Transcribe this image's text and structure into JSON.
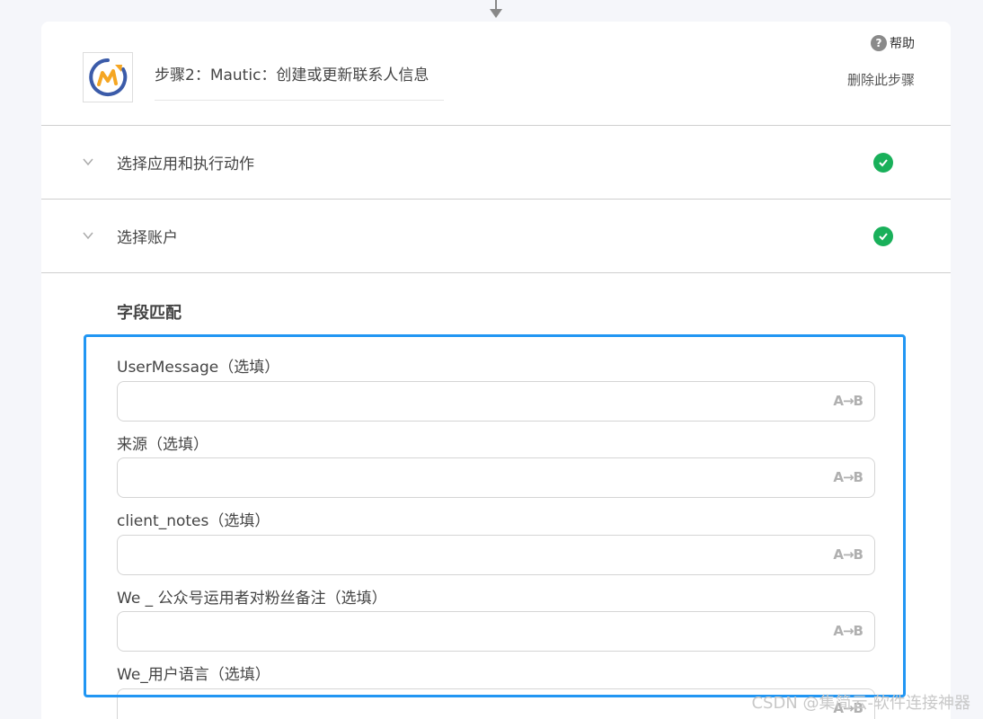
{
  "step": {
    "title": "步骤2：Mautic：创建或更新联系人信息",
    "help_label": "帮助",
    "help_icon": "?",
    "delete_label": "删除此步骤",
    "logo": "mautic-logo"
  },
  "sections": [
    {
      "label": "选择应用和执行动作",
      "status": "complete"
    },
    {
      "label": "选择账户",
      "status": "complete"
    }
  ],
  "mapping": {
    "title": "字段匹配",
    "fields": [
      {
        "label": "UserMessage（选填）",
        "value": "",
        "icon": "A→B"
      },
      {
        "label": "来源（选填）",
        "value": "",
        "icon": "A→B"
      },
      {
        "label": "client_notes（选填）",
        "value": "",
        "icon": "A→B"
      },
      {
        "label": "We _ 公众号运用者对粉丝备注（选填）",
        "value": "",
        "icon": "A→B"
      },
      {
        "label": "We_用户语言（选填）",
        "value": "",
        "icon": "A→B"
      }
    ]
  },
  "watermark": "CSDN @集简云-软件连接神器",
  "colors": {
    "highlight": "#2196f3",
    "success": "#19b05a",
    "logo_ring": "#3b5ba9",
    "logo_m": "#f5a623"
  }
}
